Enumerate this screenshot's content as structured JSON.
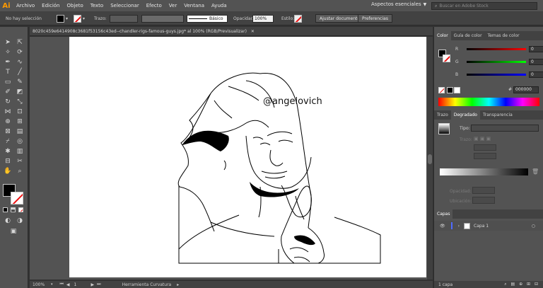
{
  "app": {
    "logo": "Ai"
  },
  "menu": [
    "Archivo",
    "Edición",
    "Objeto",
    "Texto",
    "Seleccionar",
    "Efecto",
    "Ver",
    "Ventana",
    "Ayuda"
  ],
  "workspace": "Aspectos esenciales",
  "search_placeholder": "Buscar en Adobe Stock",
  "control": {
    "selection_label": "No hay selección",
    "stroke_label": "Trazo:",
    "brush_label": "Básico",
    "opacity_label": "Opacidad:",
    "opacity_value": "100%",
    "style_label": "Estilo:",
    "adjust_doc": "Ajustar documento",
    "prefs": "Preferencias"
  },
  "document": {
    "tab_title": "8020c459e6414908c3681f53156c43ed--chandler-rigs-famous-guys.jpg* al 100% (RGB/Previsualizar)",
    "artboard_text": "@angelovich"
  },
  "status": {
    "zoom": "100%",
    "page": "1",
    "tool": "Herramienta Curvatura"
  },
  "color_panel": {
    "tabs": [
      "Color",
      "Guía de color",
      "Temas de color"
    ],
    "sliders": [
      {
        "label": "R",
        "value": "0"
      },
      {
        "label": "G",
        "value": "0"
      },
      {
        "label": "B",
        "value": "0"
      }
    ],
    "hex_label": "#",
    "hex": "000000"
  },
  "gradient_panel": {
    "tabs": [
      "Trazo",
      "Degradado",
      "Transparencia"
    ],
    "type_label": "Tipo:",
    "stroke_label": "Trazo:",
    "opacity_label": "Opacidad:",
    "location_label": "Ubicación:"
  },
  "layers_panel": {
    "title": "Capas",
    "layer_name": "Capa 1",
    "footer": "1 capa"
  }
}
